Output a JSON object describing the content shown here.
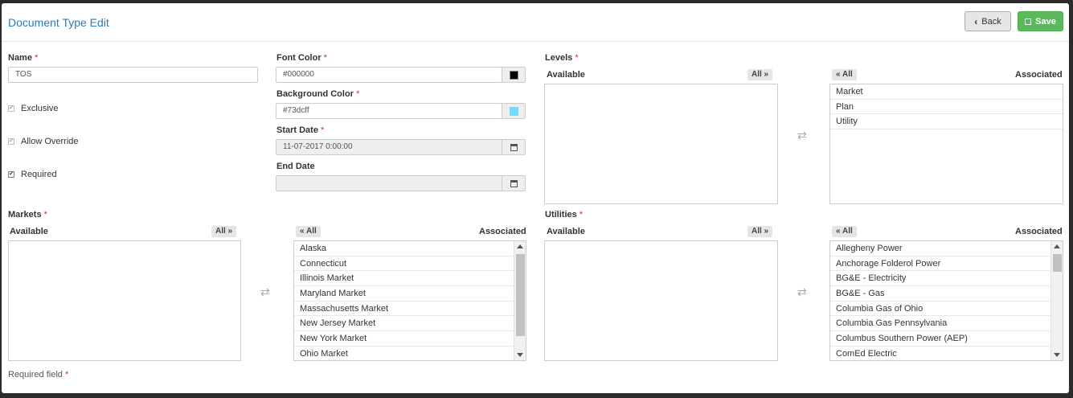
{
  "header": {
    "title": "Document Type Edit",
    "back_label": "Back",
    "save_label": "Save"
  },
  "form": {
    "name_label": "Name",
    "name_value": "TOS",
    "exclusive_label": "Exclusive",
    "allow_override_label": "Allow Override",
    "required_label": "Required",
    "font_color_label": "Font Color",
    "font_color_value": "#000000",
    "background_color_label": "Background Color",
    "background_color_value": "#73dcff",
    "start_date_label": "Start Date",
    "start_date_value": "11-07-2017 0:00:00",
    "end_date_label": "End Date",
    "end_date_value": "",
    "required_marker": "*",
    "required_field_note": "Required field"
  },
  "levels": {
    "label": "Levels",
    "available_label": "Available",
    "associated_label": "Associated",
    "all_right": "All",
    "all_left": "All",
    "associated": [
      "Market",
      "Plan",
      "Utility"
    ]
  },
  "markets": {
    "label": "Markets",
    "available_label": "Available",
    "associated_label": "Associated",
    "all_right": "All",
    "all_left": "All",
    "associated": [
      "Alaska",
      "Connecticut",
      "Illinois Market",
      "Maryland Market",
      "Massachusetts Market",
      "New Jersey Market",
      "New York Market",
      "Ohio Market"
    ]
  },
  "utilities": {
    "label": "Utilities",
    "available_label": "Available",
    "associated_label": "Associated",
    "all_right": "All",
    "all_left": "All",
    "associated": [
      "Allegheny Power",
      "Anchorage Folderol Power",
      "BG&E - Electricity",
      "BG&E - Gas",
      "Columbia Gas of Ohio",
      "Columbia Gas Pennsylvania",
      "Columbus Southern Power (AEP)",
      "ComEd Electric"
    ]
  },
  "colors": {
    "accent": "#2a7ab8",
    "save": "#5cb85c",
    "swatch_font": "#000000",
    "swatch_bg": "#73dcff"
  }
}
